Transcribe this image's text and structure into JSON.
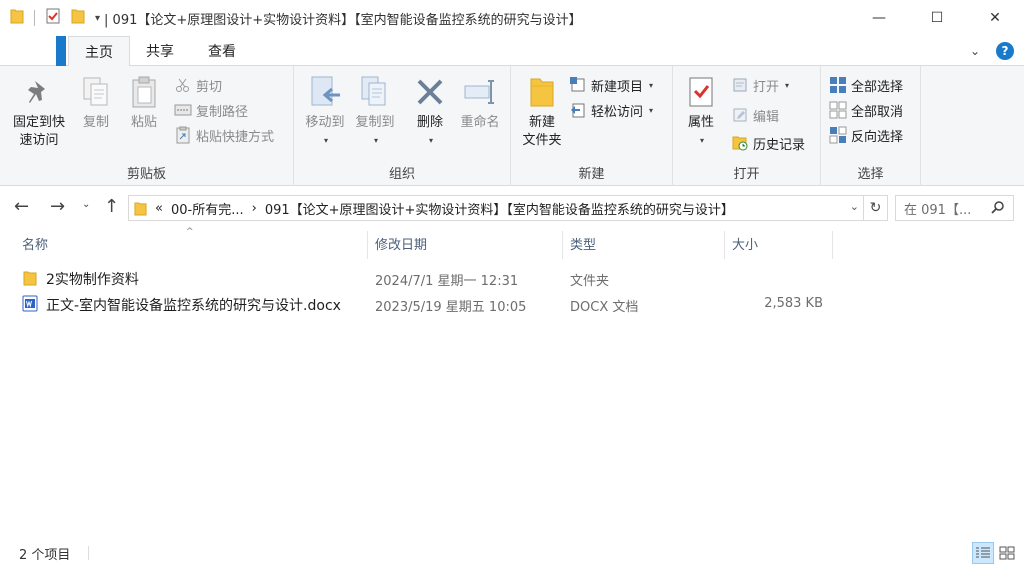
{
  "window": {
    "title": "| 091【论文+原理图设计+实物设计资料】【室内智能设备监控系统的研究与设计】",
    "minimize": "—",
    "maximize": "☐",
    "close": "✕"
  },
  "tabs": {
    "home": "主页",
    "share": "共享",
    "view": "查看"
  },
  "ribbon": {
    "clipboard": {
      "label": "剪贴板",
      "pin_line1": "固定到快",
      "pin_line2": "速访问",
      "copy": "复制",
      "paste": "粘贴",
      "cut": "剪切",
      "copy_path": "复制路径",
      "paste_shortcut": "粘贴快捷方式"
    },
    "organize": {
      "label": "组织",
      "move_to": "移动到",
      "copy_to": "复制到",
      "delete": "删除",
      "rename": "重命名"
    },
    "new": {
      "label": "新建",
      "new_folder_line1": "新建",
      "new_folder_line2": "文件夹",
      "new_item": "新建项目",
      "easy_access": "轻松访问"
    },
    "open": {
      "label": "打开",
      "properties": "属性",
      "open": "打开",
      "edit": "编辑",
      "history": "历史记录"
    },
    "select": {
      "label": "选择",
      "select_all": "全部选择",
      "select_none": "全部取消",
      "invert": "反向选择"
    }
  },
  "address": {
    "prefix": "«",
    "crumb1": "00-所有完...",
    "arrow": "›",
    "crumb2": "091【论文+原理图设计+实物设计资料】【室内智能设备监控系统的研究与设计】",
    "search_placeholder": "在 091【..."
  },
  "columns": {
    "name": "名称",
    "modified": "修改日期",
    "type": "类型",
    "size": "大小"
  },
  "files": [
    {
      "name": "2实物制作资料",
      "modified": "2024/7/1 星期一 12:31",
      "type": "文件夹",
      "size": "",
      "icon": "folder-icon"
    },
    {
      "name": "正文-室内智能设备监控系统的研究与设计.docx",
      "modified": "2023/5/19 星期五 10:05",
      "type": "DOCX 文档",
      "size": "2,583 KB",
      "icon": "docx-icon"
    }
  ],
  "status": {
    "count": "2 个项目"
  },
  "colors": {
    "accent": "#1979ca",
    "folder": "#f5c542",
    "header_text": "#4c607a"
  }
}
